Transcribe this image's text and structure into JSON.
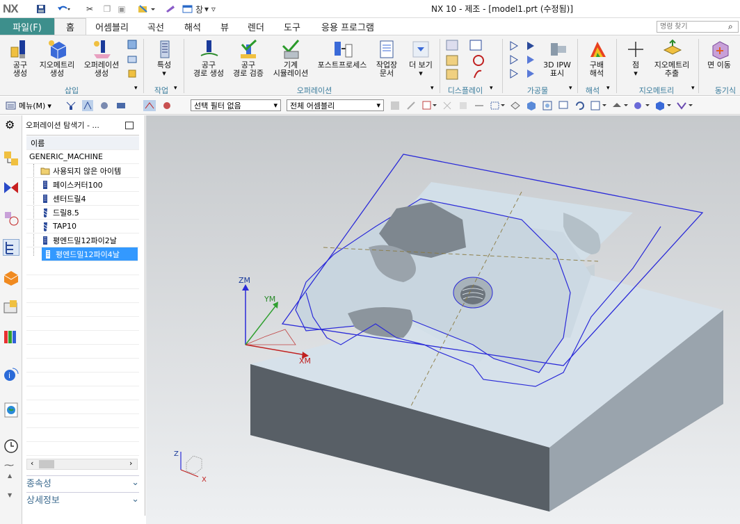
{
  "app": {
    "logo": "NX",
    "window_title": "NX 10 - 제조 - [model1.prt (수정됨)]",
    "window_menu": "창"
  },
  "menu": {
    "file_tab": "파일(F)",
    "tabs": [
      "홈",
      "어셈블리",
      "곡선",
      "해석",
      "뷰",
      "렌더",
      "도구",
      "응용 프로그램"
    ],
    "search_placeholder": "명령 찾기"
  },
  "ribbon": {
    "buttons": [
      {
        "label1": "공구",
        "label2": "생성",
        "icon": "tool-create-icon"
      },
      {
        "label1": "지오메트리",
        "label2": "생성",
        "icon": "geometry-create-icon"
      },
      {
        "label1": "오퍼레이션",
        "label2": "생성",
        "icon": "operation-create-icon"
      },
      {
        "label1": "특성",
        "label2": "",
        "icon": "properties-icon"
      },
      {
        "label1": "공구",
        "label2": "경로 생성",
        "icon": "generate-toolpath-icon"
      },
      {
        "label1": "공구",
        "label2": "경로 검증",
        "icon": "verify-toolpath-icon"
      },
      {
        "label1": "기계",
        "label2": "시뮬레이션",
        "icon": "machine-simulation-icon"
      },
      {
        "label1": "포스트프로세스",
        "label2": "",
        "icon": "postprocess-icon"
      },
      {
        "label1": "작업장",
        "label2": "문서",
        "icon": "shop-doc-icon"
      },
      {
        "label1": "더 보기",
        "label2": "",
        "icon": "more-icon"
      },
      {
        "label1": "3D IPW",
        "label2": "표시",
        "icon": "3d-ipw-icon"
      },
      {
        "label1": "구배",
        "label2": "해석",
        "icon": "draft-analysis-icon"
      },
      {
        "label1": "점",
        "label2": "",
        "icon": "point-icon"
      },
      {
        "label1": "지오메트리",
        "label2": "추출",
        "icon": "extract-geometry-icon"
      },
      {
        "label1": "면 이동",
        "label2": "",
        "icon": "move-face-icon"
      }
    ],
    "groups": [
      "삽입",
      "작업",
      "오퍼레이션",
      "디스플레이",
      "가공물",
      "해석",
      "지오메트리",
      "동기식"
    ]
  },
  "toolbar2": {
    "menu_label": "메뉴(M)",
    "selection_filter": "선택 필터 없음",
    "assembly_scope": "전체 어셈블리"
  },
  "navigator": {
    "title": "오퍼레이션 탐색기 - ...",
    "column": "이름",
    "root": "GENERIC_MACHINE",
    "items": [
      {
        "label": "사용되지 않은 아이템",
        "icon": "folder-icon"
      },
      {
        "label": "페이스커터100",
        "icon": "mill-tool-icon"
      },
      {
        "label": "센터드릴4",
        "icon": "mill-tool-icon"
      },
      {
        "label": "드릴8.5",
        "icon": "drill-tool-icon"
      },
      {
        "label": "TAP10",
        "icon": "drill-tool-icon"
      },
      {
        "label": "평엔드밀12파이2날",
        "icon": "mill-tool-icon"
      },
      {
        "label": "평엔드밀12파이4날",
        "icon": "mill-tool-icon"
      }
    ],
    "footer": [
      "종속성",
      "상세정보"
    ]
  },
  "viewport": {
    "axes": {
      "z": "ZM",
      "y": "YM",
      "x": "XM",
      "mini_z": "Z",
      "mini_x": "X"
    }
  },
  "colors": {
    "file_tab": "#3d8f8c",
    "selection": "#3399ff",
    "group_label": "#3a7c9c",
    "edge": "#2a2ad8"
  }
}
